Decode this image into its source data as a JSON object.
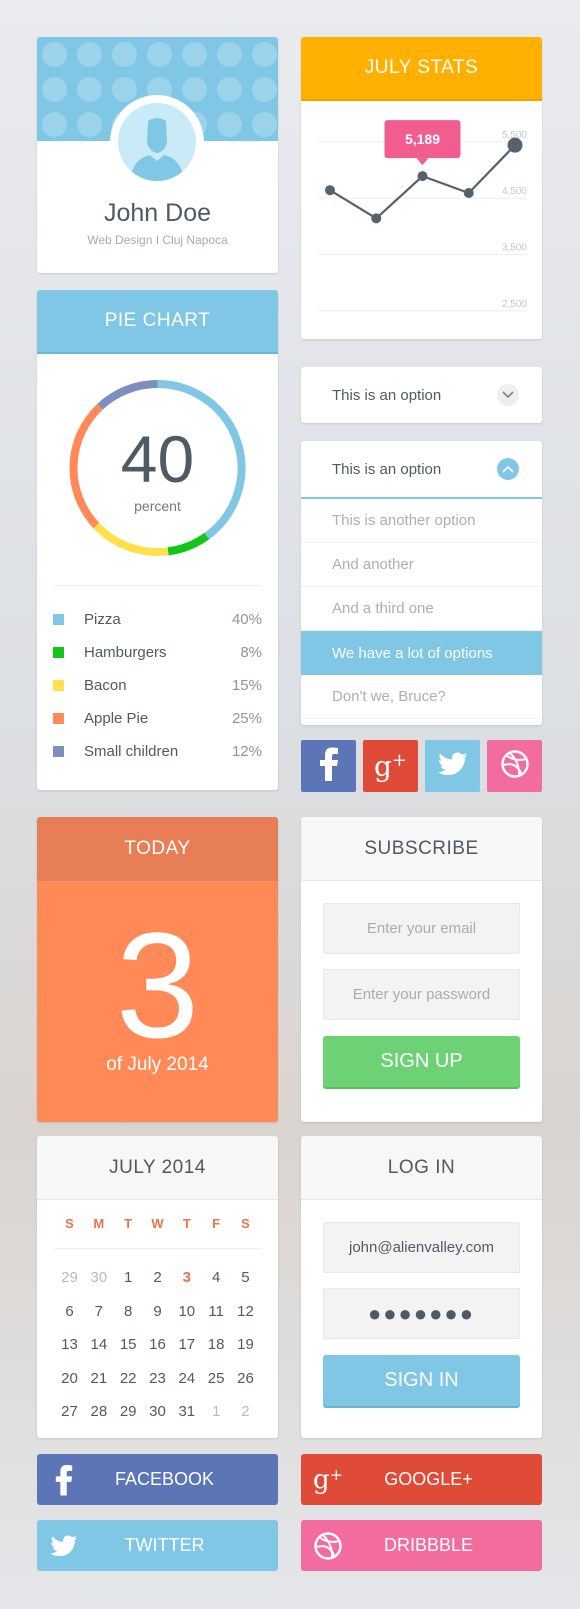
{
  "profile": {
    "name": "John Doe",
    "subtitle": "Web Design I Cluj Napoca"
  },
  "stats": {
    "title": "JULY STATS",
    "tooltip": "5,189",
    "y_ticks": [
      "5,500",
      "4,500",
      "3,500",
      "2,500"
    ]
  },
  "chart_data": {
    "type": "line",
    "title": "JULY STATS",
    "x": [
      1,
      2,
      3,
      4,
      5
    ],
    "series": [
      {
        "values": [
          4500,
          4000,
          4750,
          4450,
          5300
        ]
      }
    ],
    "ylim": [
      2000,
      5800
    ],
    "y_ticks": [
      5500,
      4500,
      3500,
      2500
    ],
    "annotation": {
      "x": 3,
      "label": "5,189"
    },
    "grid": true
  },
  "pie": {
    "title": "PIE CHART",
    "value": "40",
    "unit": "percent",
    "items": [
      {
        "label": "Pizza",
        "pct": "40%",
        "value": 40,
        "color": "#7fc7e5"
      },
      {
        "label": "Hamburgers",
        "pct": "8%",
        "value": 8,
        "color": "#12c719"
      },
      {
        "label": "Bacon",
        "pct": "15%",
        "value": 15,
        "color": "#ffe04a"
      },
      {
        "label": "Apple Pie",
        "pct": "25%",
        "value": 25,
        "color": "#ff8a57"
      },
      {
        "label": "Small children",
        "pct": "12%",
        "value": 12,
        "color": "#7d8fbf"
      }
    ]
  },
  "dropdown_closed": {
    "label": "This is an option"
  },
  "dropdown_open": {
    "label": "This is an option",
    "options": [
      {
        "label": "This is another option",
        "active": false
      },
      {
        "label": "And another",
        "active": false
      },
      {
        "label": "And a third one",
        "active": false
      },
      {
        "label": "We have a lot of options",
        "active": true
      },
      {
        "label": "Don't we, Bruce?",
        "active": false
      }
    ]
  },
  "social_squares": [
    {
      "name": "facebook",
      "icon": "facebook-icon",
      "color": "#5b75b7"
    },
    {
      "name": "google-plus",
      "icon": "google-plus-icon",
      "color": "#e04b38"
    },
    {
      "name": "twitter",
      "icon": "twitter-icon",
      "color": "#7fc7e5"
    },
    {
      "name": "dribbble",
      "icon": "dribbble-icon",
      "color": "#f26c9f"
    }
  ],
  "today": {
    "title": "TODAY",
    "day": "3",
    "subtitle": "of July 2014"
  },
  "subscribe": {
    "title": "SUBSCRIBE",
    "email_placeholder": "Enter your email",
    "password_placeholder": "Enter your password",
    "button": "SIGN UP"
  },
  "calendar": {
    "title": "JULY 2014",
    "weekdays": [
      "S",
      "M",
      "T",
      "W",
      "T",
      "F",
      "S"
    ],
    "weeks": [
      [
        "29",
        "30",
        "1",
        "2",
        "3",
        "4",
        "5"
      ],
      [
        "6",
        "7",
        "8",
        "9",
        "10",
        "11",
        "12"
      ],
      [
        "13",
        "14",
        "15",
        "16",
        "17",
        "18",
        "19"
      ],
      [
        "20",
        "21",
        "22",
        "23",
        "24",
        "25",
        "26"
      ],
      [
        "27",
        "28",
        "29",
        "30",
        "31",
        "1",
        "2"
      ]
    ],
    "today": "3"
  },
  "login": {
    "title": "LOG IN",
    "email": "john@alienvalley.com",
    "password": "●●●●●●●",
    "button": "SIGN IN"
  },
  "social_buttons": {
    "facebook": {
      "label": "FACEBOOK",
      "color": "#5b75b7"
    },
    "google": {
      "label": "GOOGLE+",
      "color": "#e04b38"
    },
    "twitter": {
      "label": "TWITTER",
      "color": "#7fc7e5"
    },
    "dribbble": {
      "label": "DRIBBBLE",
      "color": "#f26c9f"
    }
  }
}
